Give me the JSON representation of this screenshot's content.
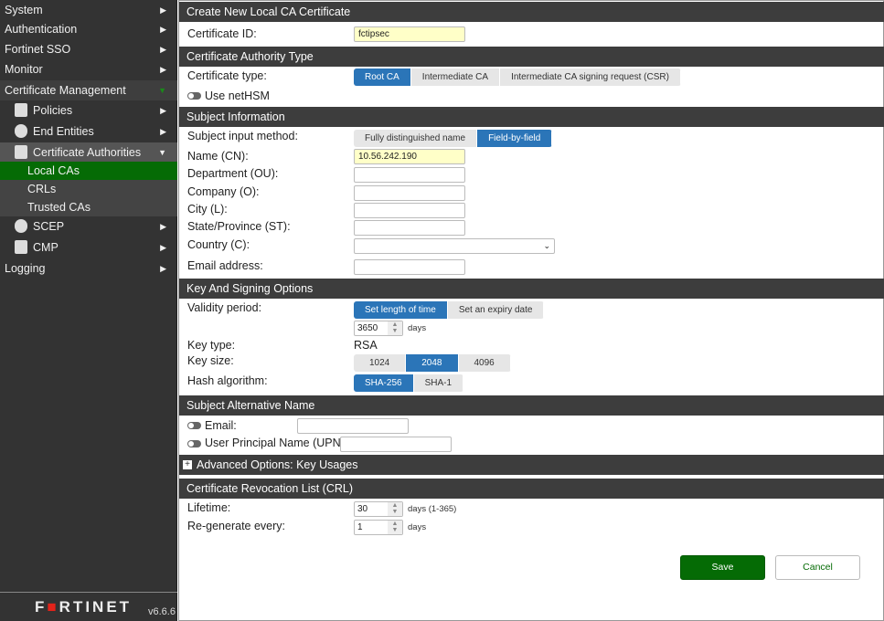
{
  "sidebar": {
    "items": [
      "System",
      "Authentication",
      "Fortinet SSO",
      "Monitor",
      "Certificate Management",
      "Policies",
      "End Entities",
      "Certificate Authorities",
      "Local CAs",
      "CRLs",
      "Trusted CAs",
      "SCEP",
      "CMP",
      "Logging"
    ],
    "brand": "FORTINET",
    "version": "v6.6.6"
  },
  "form": {
    "title": "Create New Local CA Certificate",
    "cert_id_label": "Certificate ID:",
    "cert_id": "fctipsec",
    "ca_type_header": "Certificate Authority Type",
    "cert_type_label": "Certificate type:",
    "cert_types": [
      "Root CA",
      "Intermediate CA",
      "Intermediate CA signing request (CSR)"
    ],
    "nethsm_label": "Use netHSM",
    "subject_header": "Subject Information",
    "input_method_label": "Subject input method:",
    "input_methods": [
      "Fully distinguished name",
      "Field-by-field"
    ],
    "cn_label": "Name (CN):",
    "cn": "10.56.242.190",
    "ou_label": "Department (OU):",
    "o_label": "Company (O):",
    "l_label": "City (L):",
    "st_label": "State/Province (ST):",
    "c_label": "Country (C):",
    "email_label": "Email address:",
    "key_header": "Key And Signing Options",
    "validity_label": "Validity period:",
    "validity_options": [
      "Set length of time",
      "Set an expiry date"
    ],
    "validity_days": "3650",
    "days": "days",
    "key_type_label": "Key type:",
    "key_type": "RSA",
    "key_size_label": "Key size:",
    "key_sizes": [
      "1024",
      "2048",
      "4096"
    ],
    "hash_label": "Hash algorithm:",
    "hashes": [
      "SHA-256",
      "SHA-1"
    ],
    "san_header": "Subject Alternative Name",
    "san_email_label": "Email:",
    "san_upn_label": "User Principal Name (UPN):",
    "advanced_header": "Advanced Options: Key Usages",
    "crl_header": "Certificate Revocation List (CRL)",
    "lifetime_label": "Lifetime:",
    "lifetime": "30",
    "lifetime_unit": "days (1-365)",
    "regen_label": "Re-generate every:",
    "regen": "1",
    "regen_unit": "days",
    "save": "Save",
    "cancel": "Cancel"
  },
  "colors": {
    "accent": "#2b75b8",
    "save": "#056b05",
    "selected_nav": "#056b05"
  }
}
